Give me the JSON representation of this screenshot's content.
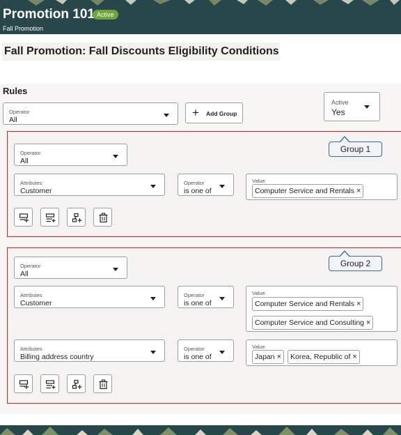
{
  "header": {
    "title": "Promotion 101",
    "badge": "Active",
    "subtitle": "Fall Promotion"
  },
  "page_heading": "Fall Promotion: Fall Discounts Eligibility Conditions",
  "rules": {
    "label": "Rules",
    "operator": {
      "label": "Operator",
      "value": "All"
    },
    "add_group_label": "Add Group",
    "active": {
      "label": "Active",
      "value": "Yes"
    }
  },
  "groups": [
    {
      "callout": "Group 1",
      "operator": {
        "label": "Operator",
        "value": "All"
      },
      "conditions": [
        {
          "attribute": {
            "label": "Attributes",
            "value": "Customer"
          },
          "operator": {
            "label": "Operator",
            "value": "is one of"
          },
          "value_label": "Value",
          "chips": [
            "Computer Service and Rentals"
          ]
        }
      ]
    },
    {
      "callout": "Group 2",
      "operator": {
        "label": "Operator",
        "value": "All"
      },
      "conditions": [
        {
          "attribute": {
            "label": "Attributes",
            "value": "Customer"
          },
          "operator": {
            "label": "Operator",
            "value": "is one of"
          },
          "value_label": "Value",
          "chips": [
            "Computer Service and Rentals",
            "Computer Service and Consulting"
          ]
        },
        {
          "attribute": {
            "label": "Attributes",
            "value": "Billing address country"
          },
          "operator": {
            "label": "Operator",
            "value": "is one of"
          },
          "value_label": "Value",
          "chips": [
            "Japan",
            "Korea, Republic of"
          ]
        }
      ]
    }
  ],
  "chip_remove_glyph": "×",
  "icons": [
    "add-condition-icon",
    "add-rule-icon",
    "add-subgroup-icon",
    "delete-icon"
  ],
  "colors": {
    "header_bg": "#27474b",
    "badge_bg": "#6fa53c",
    "group_border": "#c8232c",
    "callout_border": "#3a6c8a"
  }
}
